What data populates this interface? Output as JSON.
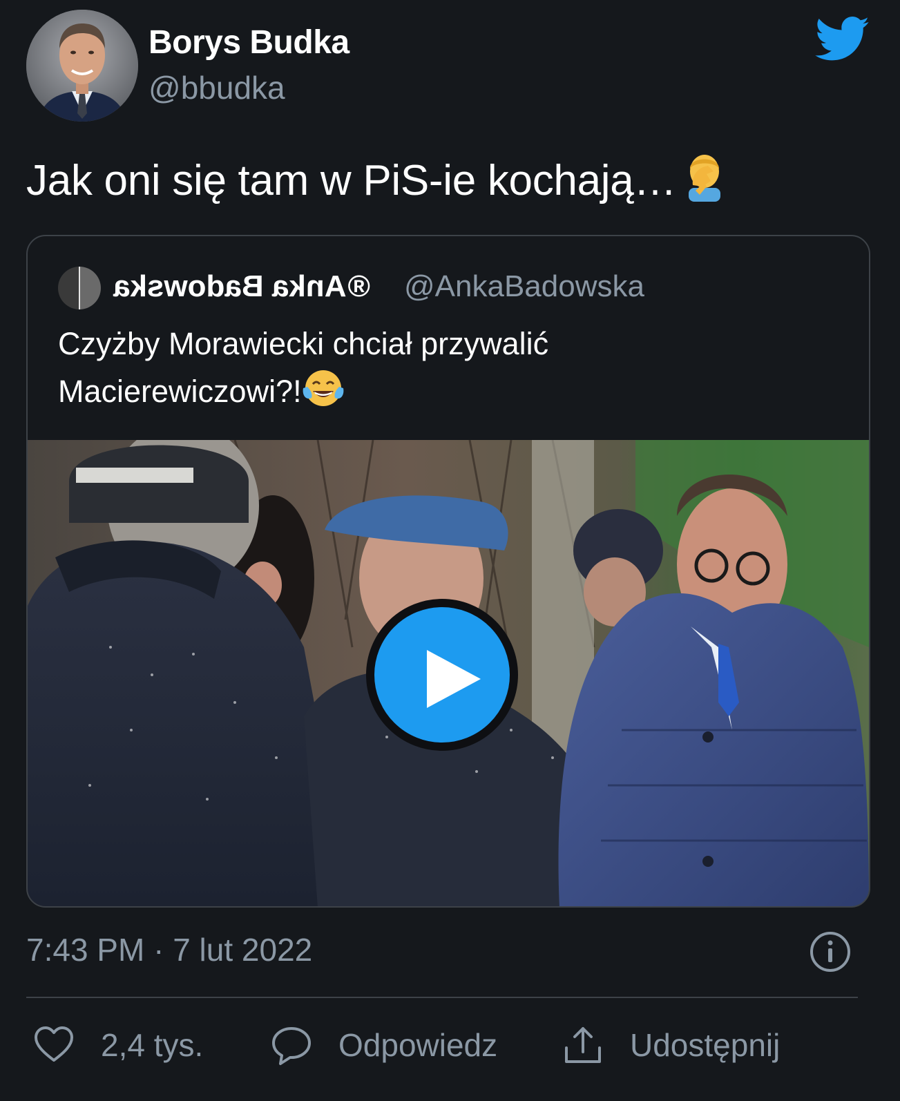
{
  "author": {
    "name": "Borys Budka",
    "handle": "@bbudka"
  },
  "tweet": {
    "text": "Jak oni się tam w PiS-ie kochają…",
    "emoji": "facepalm-emoji"
  },
  "quote": {
    "name_mirrored": "Anka Badowska",
    "name_suffix": "®",
    "handle": "@AnkaBadowska",
    "text_line1": "Czyżby Morawiecki chciał przywalić",
    "text_line2": "Macierewiczowi?!",
    "emoji": "tears-of-joy-emoji"
  },
  "meta": {
    "timestamp": "7:43 PM · 7 lut 2022"
  },
  "actions": {
    "like_count": "2,4 tys.",
    "reply_label": "Odpowiedz",
    "share_label": "Udostępnij"
  },
  "colors": {
    "background": "#15181c",
    "accent": "#1d9bf0",
    "secondary_text": "#8b98a5",
    "border": "#3d4248"
  },
  "icons": [
    "twitter-bird-icon",
    "play-icon",
    "info-icon",
    "heart-icon",
    "reply-bubble-icon",
    "share-icon"
  ]
}
